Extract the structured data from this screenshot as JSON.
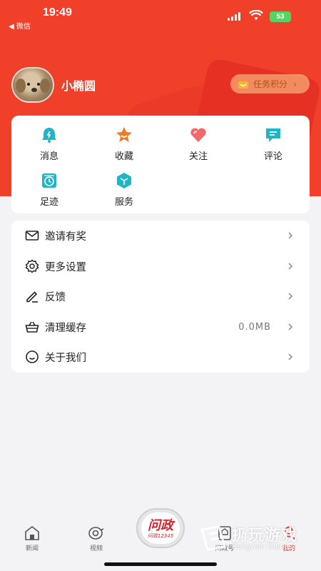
{
  "status_bar": {
    "time": "19:49",
    "back_label": "◀ 微信",
    "battery": "53"
  },
  "profile": {
    "username": "小椭圆",
    "task_button_label": "任务积分"
  },
  "grid": [
    {
      "label": "消息",
      "icon": "bell-icon"
    },
    {
      "label": "收藏",
      "icon": "star-icon"
    },
    {
      "label": "关注",
      "icon": "heart-icon"
    },
    {
      "label": "评论",
      "icon": "comment-icon"
    },
    {
      "label": "足迹",
      "icon": "clock-icon"
    },
    {
      "label": "服务",
      "icon": "service-icon"
    }
  ],
  "menu": [
    {
      "label": "邀请有奖",
      "icon": "mail-icon",
      "value": ""
    },
    {
      "label": "更多设置",
      "icon": "gear-icon",
      "value": ""
    },
    {
      "label": "反馈",
      "icon": "edit-icon",
      "value": ""
    },
    {
      "label": "清理缓存",
      "icon": "basket-icon",
      "value": "0.0MB"
    },
    {
      "label": "关于我们",
      "icon": "smile-icon",
      "value": ""
    }
  ],
  "tabbar": [
    {
      "label": "新闻",
      "icon": "home-icon"
    },
    {
      "label": "视频",
      "icon": "video-icon"
    },
    {
      "label": "问政",
      "icon": "wenzheng-logo"
    },
    {
      "label": "问政号",
      "icon": "account-icon"
    },
    {
      "label": "我的",
      "icon": "user-icon"
    }
  ],
  "center_button": {
    "title": "问政",
    "subtitle": "问政12345"
  },
  "watermark": {
    "cn": "扔玩游戏",
    "en": "Rengwan Games"
  },
  "colors": {
    "brand_red": "#f1402a",
    "teal": "#1fb5c4",
    "orange": "#f07a2b",
    "pink": "#f06a6a",
    "active_tab": "#e8342a"
  }
}
